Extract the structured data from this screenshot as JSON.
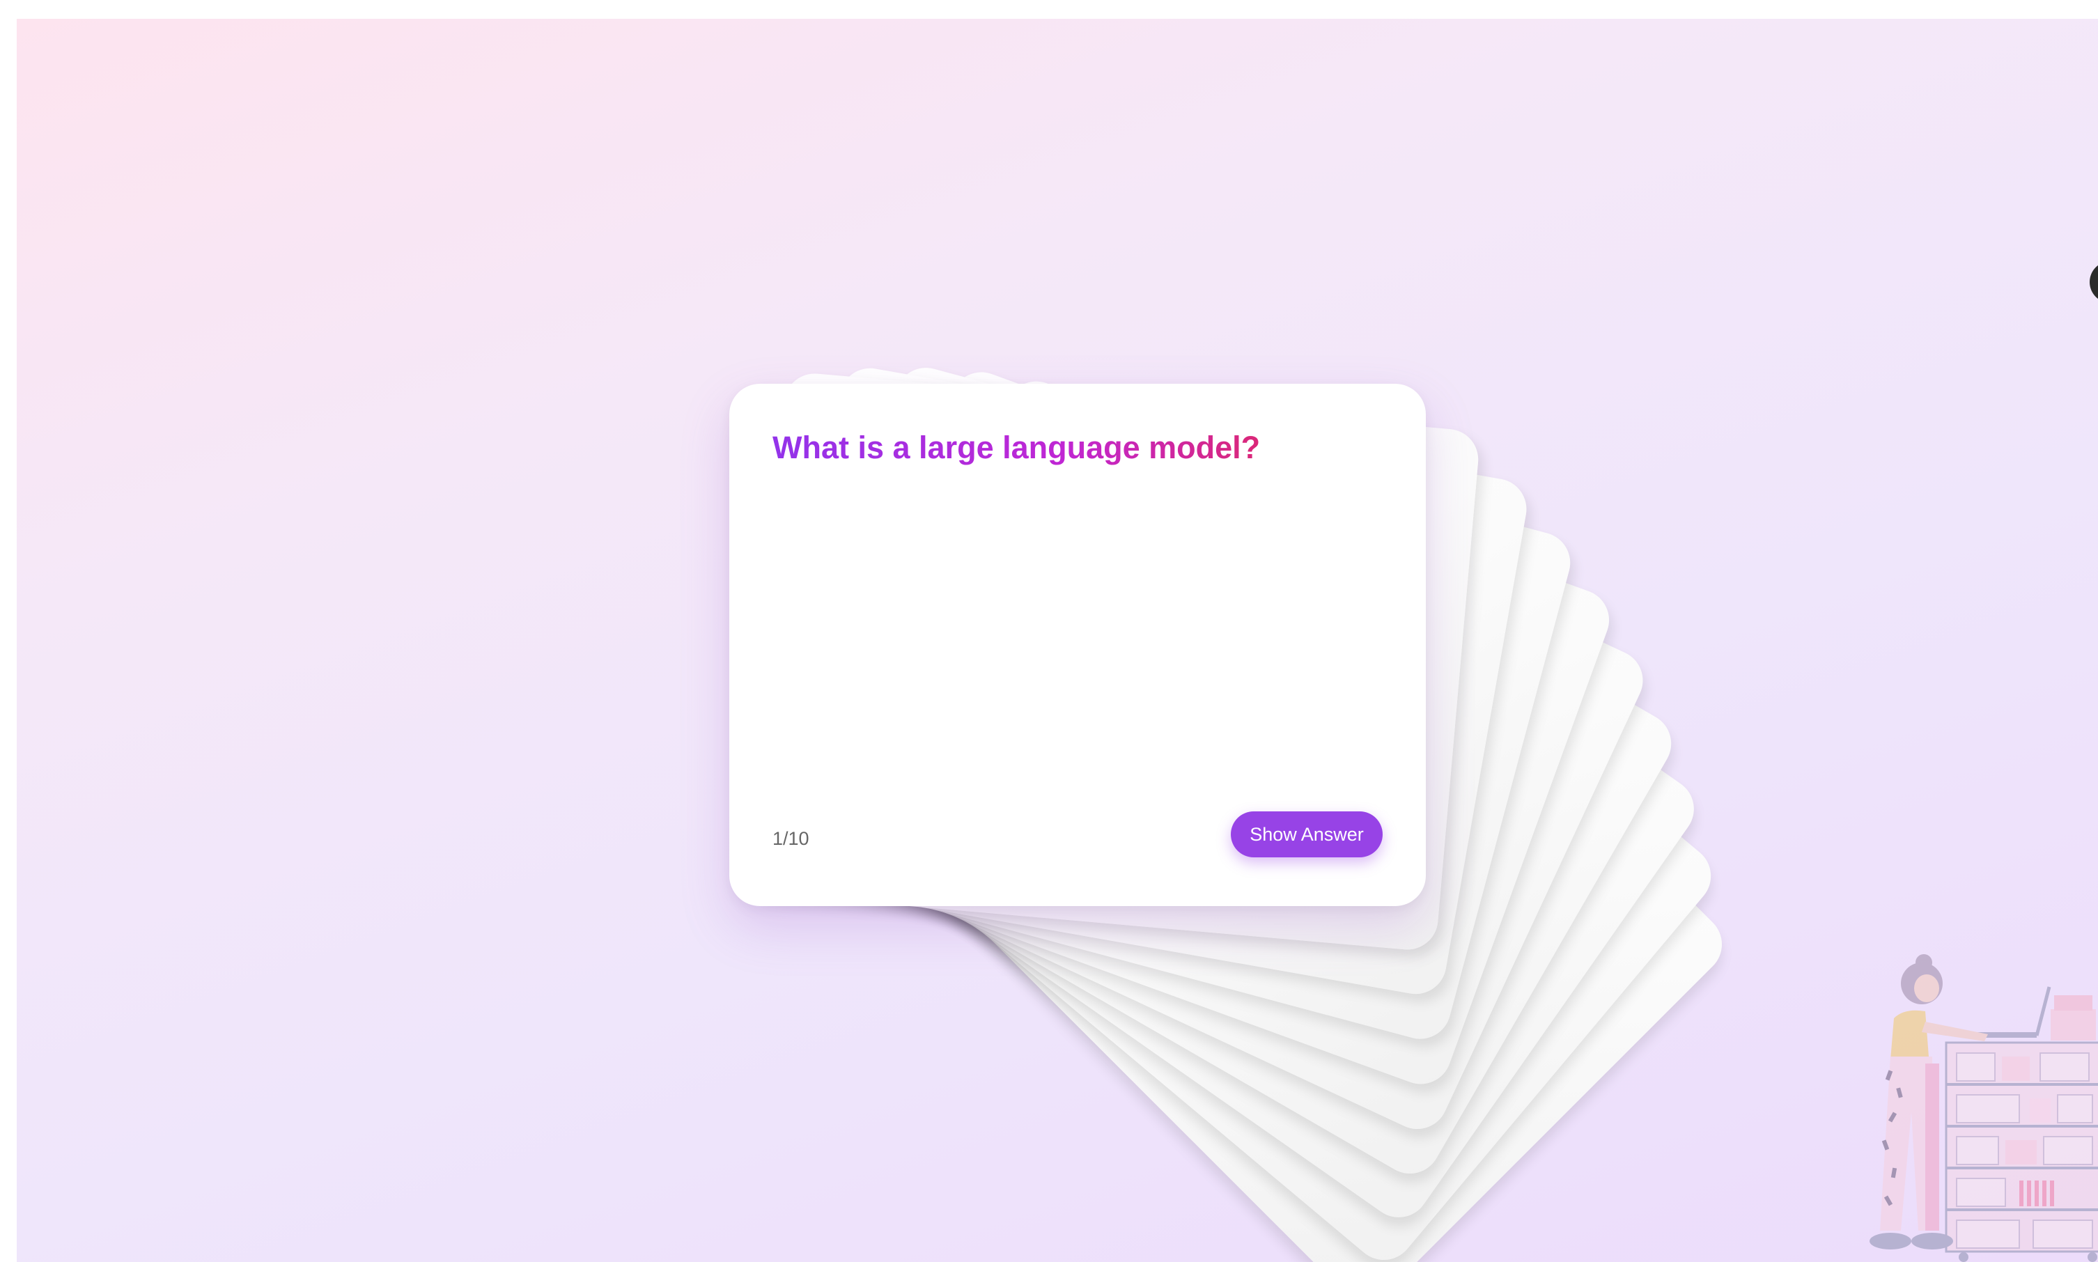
{
  "flashcard": {
    "question": "What is a large language model?",
    "counter": "1/10",
    "show_answer_label": "Show Answer",
    "position": 1,
    "total": 10
  },
  "colors": {
    "accent": "#9743e6",
    "title_gradient_start": "#9333ea",
    "title_gradient_end": "#db2777",
    "background_start": "#fde4ef",
    "background_end": "#ecdcfb"
  },
  "icons": {
    "illustration": "woman-at-laptop-with-bookshelf-illustration"
  }
}
